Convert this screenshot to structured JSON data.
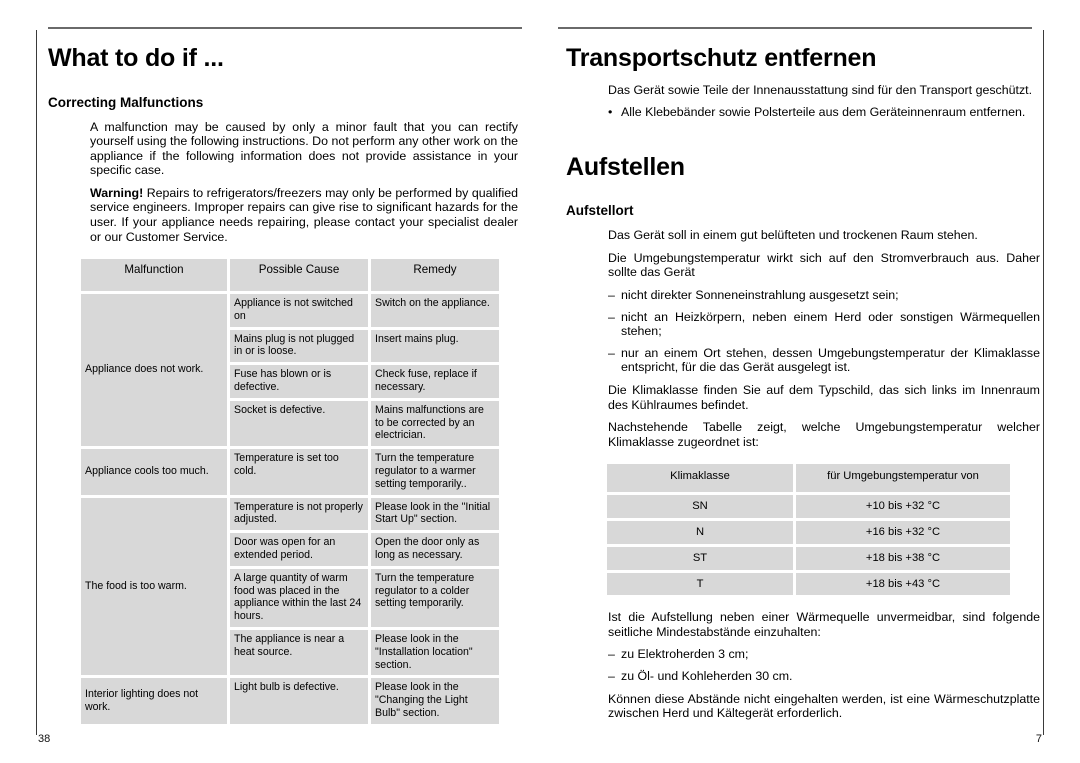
{
  "spread": {
    "left_page": {
      "folio": "38",
      "title": "What to do if ...",
      "subtitle": "Correcting Malfunctions",
      "paragraphs": [
        "A malfunction may be caused by only a minor fault that you can rectify yourself using the following instructions. Do not perform any other work on the appliance if the following information does not provide assistance in your specific case."
      ],
      "warning_label": "Warning!",
      "warning_text": " Repairs to refrigerators/freezers may only be performed by qualified service engineers. Improper repairs can give rise to significant hazards for the user. If your appliance needs repairing, please contact your specialist dealer or our Customer Service.",
      "table": {
        "headers": [
          "Malfunction",
          "Possible Cause",
          "Remedy"
        ],
        "groups": [
          {
            "malfunction": "Appliance does not work.",
            "rows": [
              {
                "cause": "Appliance is not switched on",
                "remedy": "Switch on the appliance."
              },
              {
                "cause": "Mains plug is not plugged in or is loose.",
                "remedy": "Insert mains plug."
              },
              {
                "cause": "Fuse has blown or is defective.",
                "remedy": "Check fuse, replace if necessary."
              },
              {
                "cause": "Socket is defective.",
                "remedy": "Mains malfunctions are to be corrected by an electrician."
              }
            ]
          },
          {
            "malfunction": "Appliance cools too much.",
            "rows": [
              {
                "cause": "Temperature is set too cold.",
                "remedy": "Turn the temperature regulator to a warmer setting temporarily.."
              }
            ]
          },
          {
            "malfunction": "The food is too warm.",
            "rows": [
              {
                "cause": "Temperature is not properly adjusted.",
                "remedy": "Please look in the \"Initial Start Up\" section."
              },
              {
                "cause": "Door was open for an extended period.",
                "remedy": "Open the door only as long as necessary."
              },
              {
                "cause": "A large quantity of warm food was placed in the appliance within the last 24 hours.",
                "remedy": "Turn the temperature regulator to a colder setting temporarily."
              },
              {
                "cause": "The appliance is near a heat source.",
                "remedy": "Please look in the \"Installation location\" section."
              }
            ]
          },
          {
            "malfunction": "Interior lighting does not work.",
            "rows": [
              {
                "cause": "Light bulb is defective.",
                "remedy": "Please look in the \"Changing the Light Bulb\" section."
              }
            ]
          }
        ]
      }
    },
    "right_page": {
      "folio": "7",
      "title_transport": "Transportschutz entfernen",
      "transport_paragraph": "Das Gerät sowie Teile der Innenausstattung sind für den Transport geschützt.",
      "transport_bullet_marker": "•",
      "transport_bullet": "Alle Klebebänder sowie Polsterteile aus dem Geräteinnenraum entfernen.",
      "title_aufstellen": "Aufstellen",
      "subtitle_aufstellort": "Aufstellort",
      "aufstellort_p1": "Das Gerät soll in einem gut belüfteten und trockenen Raum stehen.",
      "aufstellort_p2": "Die Umgebungstemperatur wirkt sich auf den Stromverbrauch aus. Daher sollte das Gerät",
      "dash_marker": "–",
      "dash_items": [
        "nicht direkter Sonneneinstrahlung ausgesetzt sein;",
        "nicht an Heizkörpern, neben einem Herd oder sonstigen Wärmequellen stehen;",
        "nur an einem Ort stehen, dessen Umgebungstemperatur der Klimaklasse entspricht, für die das Gerät ausgelegt ist."
      ],
      "klima_p1": "Die Klimaklasse finden Sie auf dem Typschild, das sich links im Innenraum des Kühlraumes befindet.",
      "klima_p2": "Nachstehende Tabelle zeigt, welche Umgebungstemperatur welcher Klimaklasse zugeordnet ist:",
      "klima_table": {
        "headers": [
          "Klimaklasse",
          "für Umgebungstemperatur von"
        ],
        "rows": [
          {
            "klasse": "SN",
            "temperatur": "+10 bis +32 °C"
          },
          {
            "klasse": "N",
            "temperatur": "+16 bis +32 °C"
          },
          {
            "klasse": "ST",
            "temperatur": "+18 bis +38 °C"
          },
          {
            "klasse": "T",
            "temperatur": "+18 bis +43 °C"
          }
        ]
      },
      "after_p1": "Ist die Aufstellung neben einer Wärmequelle unvermeidbar, sind folgende seitliche Mindestabstände einzuhalten:",
      "after_dash_items": [
        "zu Elektroherden 3 cm;",
        "zu Öl- und Kohleherden 30 cm."
      ],
      "after_p2": "Können diese Abstände nicht eingehalten werden, ist eine Wärmeschutzplatte zwischen Herd und Kältegerät erforderlich."
    }
  },
  "colors": {
    "table_cell_bg": "#d8d8d8",
    "rule": "#6a6a6a",
    "edge_rule": "#3a3a3a",
    "text": "#000000"
  }
}
